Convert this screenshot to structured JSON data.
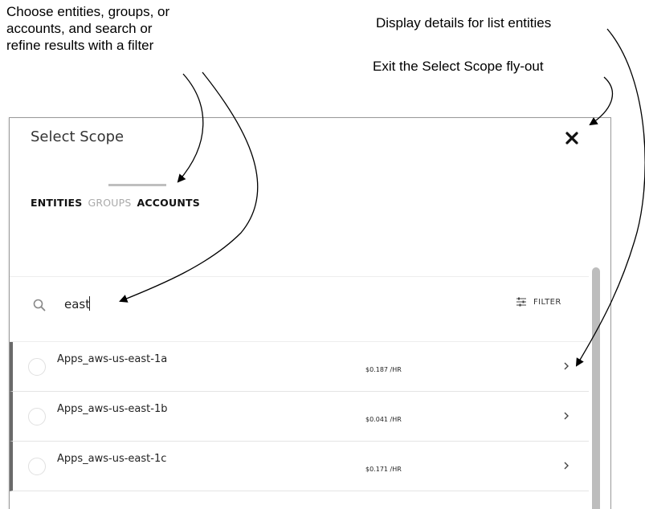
{
  "callouts": {
    "choose": "Choose entities, groups, or\naccounts, and search or\nrefine results with a filter",
    "details": "Display details for list entities",
    "exit": "Exit the Select Scope fly-out"
  },
  "flyout": {
    "title": "Select Scope",
    "close_icon": "close-icon",
    "tabs": [
      {
        "label": "ENTITIES"
      },
      {
        "label": "GROUPS"
      },
      {
        "label": "ACCOUNTS"
      }
    ],
    "search": {
      "value": "east",
      "icon": "search-icon"
    },
    "filter": {
      "label": "FILTER",
      "icon": "sliders-icon"
    },
    "rows": [
      {
        "name": "Apps_aws-us-east-1a",
        "cost": "$0.187 /HR"
      },
      {
        "name": "Apps_aws-us-east-1b",
        "cost": "$0.041 /HR"
      },
      {
        "name": "Apps_aws-us-east-1c",
        "cost": "$0.171 /HR"
      }
    ]
  },
  "colors": {
    "row_accent": "#6a6a6a",
    "tab_indicator": "#bfbfbf",
    "scrollbar": "#bdbdbd"
  }
}
